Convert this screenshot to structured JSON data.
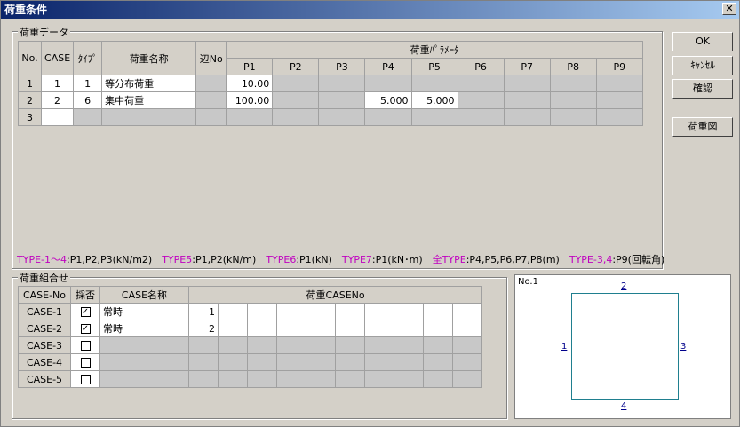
{
  "window": {
    "title": "荷重条件",
    "close": "✕"
  },
  "buttons": {
    "ok": "OK",
    "cancel": "ｷｬﾝｾﾙ",
    "confirm": "確認",
    "diagram": "荷重図"
  },
  "load_data": {
    "label": "荷重データ",
    "headers": {
      "no": "No.",
      "case": "CASE",
      "type": "ﾀｲﾌﾟ",
      "name": "荷重名称",
      "edge": "辺No",
      "params": "荷重ﾊﾟﾗﾒｰﾀ",
      "p": [
        "P1",
        "P2",
        "P3",
        "P4",
        "P5",
        "P6",
        "P7",
        "P8",
        "P9"
      ]
    },
    "rows": [
      {
        "no": "1",
        "case": "1",
        "type": "1",
        "name": "等分布荷重",
        "edge": "",
        "p": [
          "10.00",
          "",
          "",
          "",
          "",
          "",
          "",
          "",
          ""
        ]
      },
      {
        "no": "2",
        "case": "2",
        "type": "6",
        "name": "集中荷重",
        "edge": "",
        "p": [
          "100.00",
          "",
          "",
          "5.000",
          "5.000",
          "",
          "",
          "",
          ""
        ]
      },
      {
        "no": "3",
        "case": "",
        "type": "",
        "name": "",
        "edge": "",
        "p": [
          "",
          "",
          "",
          "",
          "",
          "",
          "",
          "",
          ""
        ]
      }
    ]
  },
  "type_help": [
    {
      "key": "TYPE-1～4",
      "val": ":P1,P2,P3(kN/m2)"
    },
    {
      "key": "TYPE5",
      "val": ":P1,P2(kN/m)"
    },
    {
      "key": "TYPE6",
      "val": ":P1(kN)"
    },
    {
      "key": "TYPE7",
      "val": ":P1(kN･m)"
    },
    {
      "key": "全TYPE",
      "val": ":P4,P5,P6,P7,P8(m)"
    },
    {
      "key": "TYPE-3,4",
      "val": ":P9(回転角)"
    }
  ],
  "combo": {
    "label": "荷重組合せ",
    "headers": {
      "case_no": "CASE-No",
      "adopt": "採否",
      "case_name": "CASE名称",
      "load_case_no": "荷重CASENo"
    },
    "rows": [
      {
        "case_no": "CASE-1",
        "checked": true,
        "name": "常時",
        "first": "1"
      },
      {
        "case_no": "CASE-2",
        "checked": true,
        "name": "常時",
        "first": "2"
      },
      {
        "case_no": "CASE-3",
        "checked": false,
        "name": "",
        "first": ""
      },
      {
        "case_no": "CASE-4",
        "checked": false,
        "name": "",
        "first": ""
      },
      {
        "case_no": "CASE-5",
        "checked": false,
        "name": "",
        "first": ""
      }
    ]
  },
  "preview": {
    "title": "No.1",
    "edges": {
      "top": "2",
      "left": "1",
      "right": "3",
      "bottom": "4"
    },
    "line_color": "#1f7f8f"
  }
}
